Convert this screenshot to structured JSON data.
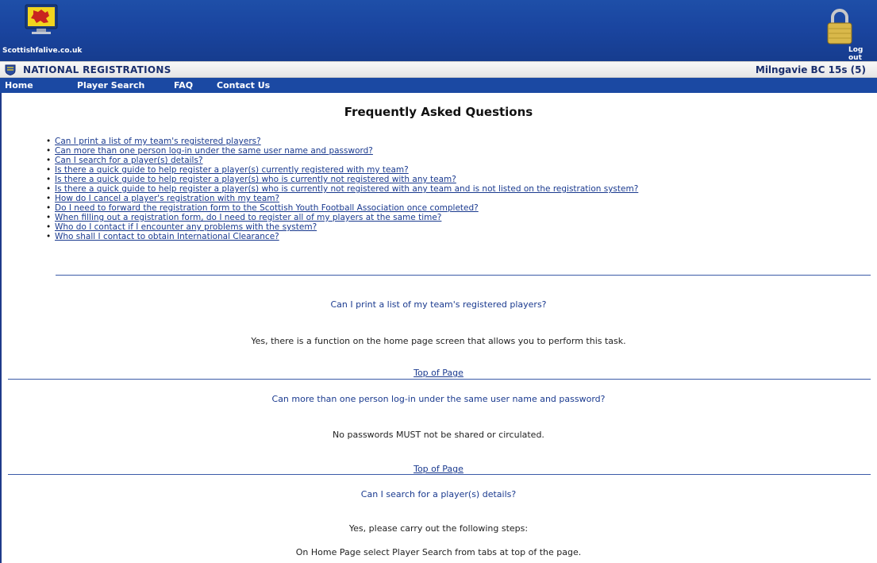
{
  "header": {
    "site_name": "Scottishfalive.co.uk",
    "logout_label": "Log out",
    "logo_icon": "football-monitor-logo-icon",
    "lock_icon": "padlock-icon"
  },
  "registration_bar": {
    "title": "NATIONAL REGISTRATIONS",
    "team": "Milngavie BC 15s (5)",
    "crest_icon": "association-crest-icon"
  },
  "nav": {
    "items": [
      {
        "label": "Home"
      },
      {
        "label": "Player Search"
      },
      {
        "label": "FAQ"
      },
      {
        "label": "Contact Us"
      }
    ]
  },
  "faq": {
    "title": "Frequently Asked Questions",
    "questions": [
      "Can I print a list of my team's registered players?",
      "Can more than one person log-in under the same user name and password?",
      "Can I search for a player(s) details?",
      "Is there a quick guide to help register a player(s) currently registered with my team?",
      "Is there a quick guide to help register a player(s) who is currently not registered with any team?",
      "Is there a quick guide to help register a player(s) who is currently not registered with any team and is not listed on the registration system?",
      "How do I cancel a player's registration with my team?",
      "Do I need to forward the registration form to the Scottish Youth Football Association once completed?",
      "When filling out a registration form, do I need to register all of my players at the same time?",
      "Who do I contact if I encounter any problems with the system?",
      "Who shall I contact to obtain International Clearance?"
    ],
    "sections": [
      {
        "question": "Can I print a list of my team's registered players?",
        "answer": "Yes, there is a function on the home page screen that allows you to perform this task.",
        "top_link": "Top of Page"
      },
      {
        "question": "Can more than one person log-in under the same user name and password?",
        "answer": "No passwords MUST not be shared or circulated.",
        "top_link": "Top of Page"
      },
      {
        "question": "Can I search for a player(s) details?",
        "answer": "Yes, please carry out the following steps:",
        "answer_step": "On Home Page select Player Search from tabs at top of the page."
      }
    ]
  },
  "colors": {
    "banner_blue": "#1a45a0",
    "nav_blue": "#1b49a3",
    "link_blue": "#1a3a8f",
    "rule_blue": "#3b5ba8"
  }
}
